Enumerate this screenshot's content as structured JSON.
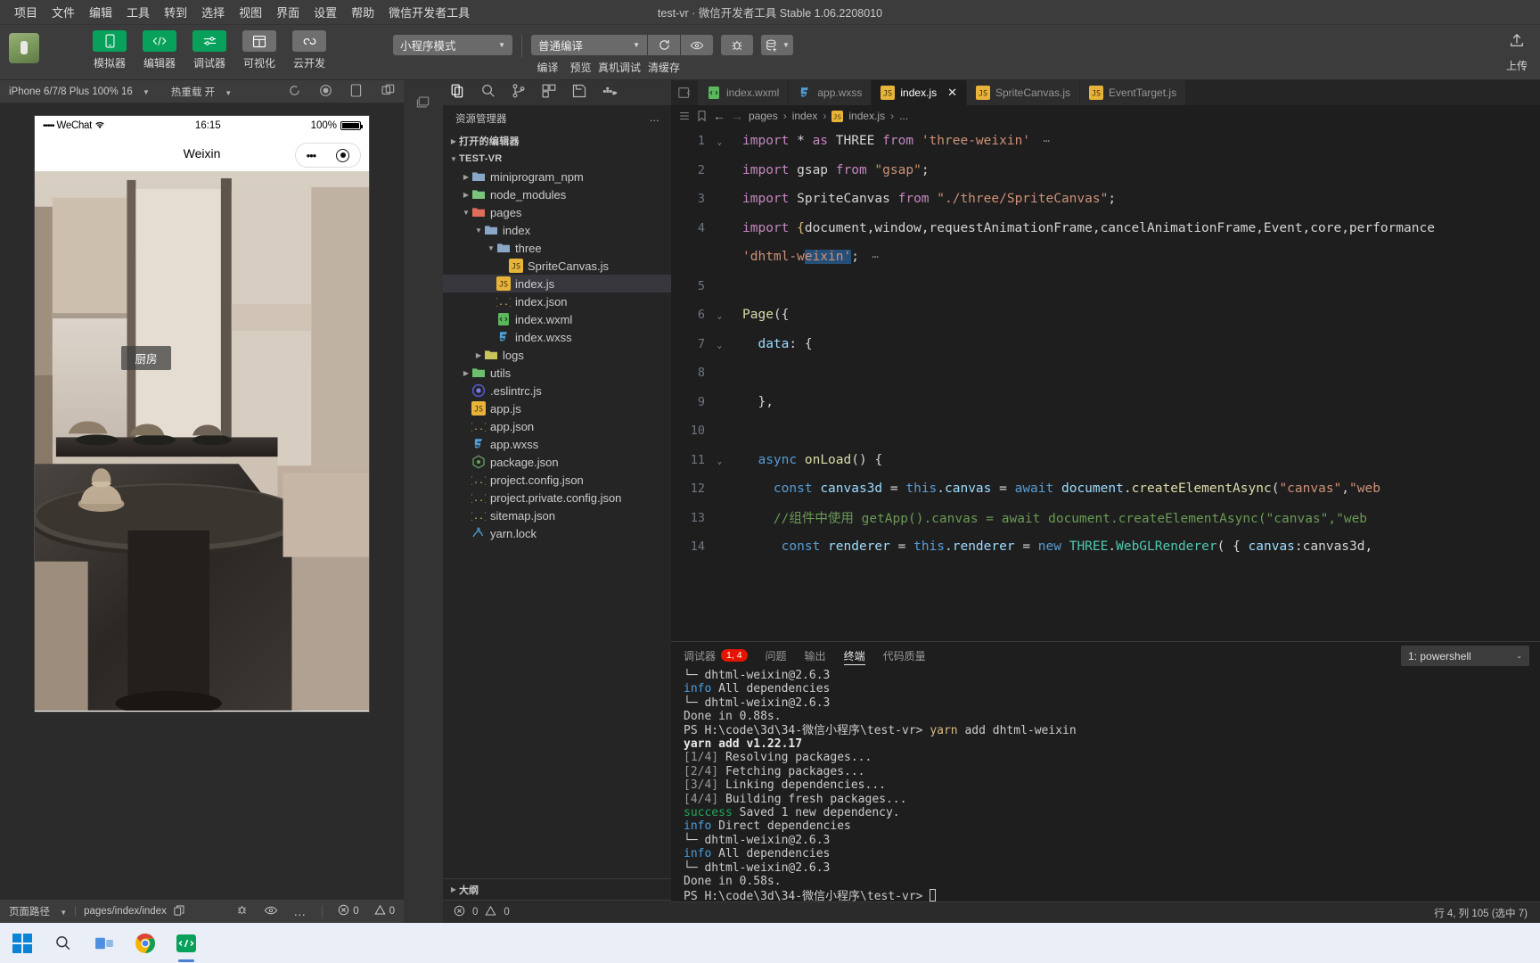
{
  "titlebar": {
    "menus": [
      "项目",
      "文件",
      "编辑",
      "工具",
      "转到",
      "选择",
      "视图",
      "界面",
      "设置",
      "帮助",
      "微信开发者工具"
    ],
    "window_title": "test-vr · 微信开发者工具 Stable 1.06.2208010"
  },
  "toolbar": {
    "buttons": [
      {
        "label": "模拟器",
        "icon": "phone-icon",
        "style": "green"
      },
      {
        "label": "编辑器",
        "icon": "code-icon",
        "style": "green"
      },
      {
        "label": "调试器",
        "icon": "sliders-icon",
        "style": "green"
      },
      {
        "label": "可视化",
        "icon": "layout-icon",
        "style": "grey"
      },
      {
        "label": "云开发",
        "icon": "cloud-icon",
        "style": "grey"
      }
    ],
    "mode_select": "小程序模式",
    "compile_select": "普通编译",
    "action_labels": [
      "编译",
      "预览",
      "真机调试",
      "清缓存"
    ],
    "upload_label": "上传",
    "upload_icon": "upload-icon"
  },
  "simulator": {
    "device": "iPhone 6/7/8 Plus 100% 16",
    "hot_reload": "热重载 开",
    "icons": [
      "refresh-icon",
      "record-icon",
      "rotate-icon",
      "detach-icon"
    ],
    "phone": {
      "carrier": "WeChat",
      "signal_dots": "•••••",
      "time": "16:15",
      "battery_percent": "100%",
      "nav_title": "Weixin",
      "capsule_more_icon": "more-dots-icon",
      "capsule_close_icon": "target-icon",
      "scene_label": "厨房"
    },
    "status": {
      "path_label": "页面路径",
      "path_value": "pages/index/index",
      "copy_icon": "copy-icon",
      "right_icons": [
        "bug-icon",
        "eye-icon",
        "more-icon"
      ],
      "errors": "0",
      "warnings": "0",
      "error_icon": "error-circle-icon",
      "warning_icon": "warning-triangle-icon"
    }
  },
  "activity_bar": {
    "items": [
      {
        "name": "explorer-icon",
        "active": true
      },
      {
        "name": "search-icon",
        "active": false
      },
      {
        "name": "source-control-icon",
        "active": false
      },
      {
        "name": "extensions-icon",
        "active": false
      },
      {
        "name": "save-icon",
        "active": false
      },
      {
        "name": "docker-icon",
        "active": false
      }
    ]
  },
  "explorer": {
    "title": "资源管理器",
    "more_icon": "ellipsis-icon",
    "open_editors": "打开的编辑器",
    "project_root": "TEST-VR",
    "outline": "大纲",
    "tree": [
      {
        "label": "miniprogram_npm",
        "depth": 1,
        "type": "folder",
        "twisty": "collapsed",
        "color": "#8aa7c7"
      },
      {
        "label": "node_modules",
        "depth": 1,
        "type": "folder",
        "twisty": "collapsed",
        "color": "#7cc47c"
      },
      {
        "label": "pages",
        "depth": 1,
        "type": "folder",
        "twisty": "expanded",
        "color": "#e06c5a"
      },
      {
        "label": "index",
        "depth": 2,
        "type": "folder",
        "twisty": "expanded",
        "color": "#8aa7c7"
      },
      {
        "label": "three",
        "depth": 3,
        "type": "folder",
        "twisty": "expanded",
        "color": "#8aa7c7"
      },
      {
        "label": "SpriteCanvas.js",
        "depth": 4,
        "type": "js",
        "twisty": "none"
      },
      {
        "label": "index.js",
        "depth": 3,
        "type": "js",
        "twisty": "none",
        "selected": true
      },
      {
        "label": "index.json",
        "depth": 3,
        "type": "json",
        "twisty": "none"
      },
      {
        "label": "index.wxml",
        "depth": 3,
        "type": "wxml",
        "twisty": "none"
      },
      {
        "label": "index.wxss",
        "depth": 3,
        "type": "wxss",
        "twisty": "none"
      },
      {
        "label": "logs",
        "depth": 2,
        "type": "folder",
        "twisty": "collapsed",
        "color": "#c9c45a"
      },
      {
        "label": "utils",
        "depth": 1,
        "type": "folder",
        "twisty": "collapsed",
        "color": "#6cbf6c"
      },
      {
        "label": ".eslintrc.js",
        "depth": 1,
        "type": "eslint",
        "twisty": "none"
      },
      {
        "label": "app.js",
        "depth": 1,
        "type": "js",
        "twisty": "none"
      },
      {
        "label": "app.json",
        "depth": 1,
        "type": "json",
        "twisty": "none"
      },
      {
        "label": "app.wxss",
        "depth": 1,
        "type": "wxss",
        "twisty": "none"
      },
      {
        "label": "package.json",
        "depth": 1,
        "type": "npm",
        "twisty": "none"
      },
      {
        "label": "project.config.json",
        "depth": 1,
        "type": "json",
        "twisty": "none"
      },
      {
        "label": "project.private.config.json",
        "depth": 1,
        "type": "json",
        "twisty": "none"
      },
      {
        "label": "sitemap.json",
        "depth": 1,
        "type": "json",
        "twisty": "none"
      },
      {
        "label": "yarn.lock",
        "depth": 1,
        "type": "yarn",
        "twisty": "none"
      }
    ]
  },
  "editor": {
    "tabs": [
      {
        "label": "index.wxml",
        "type": "wxml",
        "active": false
      },
      {
        "label": "app.wxss",
        "type": "wxss",
        "active": false
      },
      {
        "label": "index.js",
        "type": "js",
        "active": true,
        "close_icon": "close-icon"
      },
      {
        "label": "SpriteCanvas.js",
        "type": "js",
        "active": false
      },
      {
        "label": "EventTarget.js",
        "type": "js",
        "active": false
      }
    ],
    "breadcrumb": [
      "pages",
      "index",
      "index.js",
      "..."
    ],
    "breadcrumb_icons": [
      "menu-icon",
      "bookmark-icon",
      "arrow-left-icon",
      "arrow-right-icon"
    ],
    "lines": [
      {
        "n": "1",
        "fold": "expanded",
        "tokens": [
          {
            "t": "import ",
            "c": "kw"
          },
          {
            "t": "*",
            "c": "op"
          },
          {
            "t": " as ",
            "c": "kw"
          },
          {
            "t": "THREE",
            "c": "plain"
          },
          {
            "t": " from ",
            "c": "kw"
          },
          {
            "t": "'three-weixin'",
            "c": "str"
          }
        ],
        "trailing_ellipsis": true
      },
      {
        "n": "2",
        "fold": "",
        "tokens": [
          {
            "t": "import ",
            "c": "kw"
          },
          {
            "t": "gsap",
            "c": "plain"
          },
          {
            "t": " from ",
            "c": "kw"
          },
          {
            "t": "\"gsap\"",
            "c": "str"
          },
          {
            "t": ";",
            "c": "op"
          }
        ]
      },
      {
        "n": "3",
        "fold": "",
        "tokens": [
          {
            "t": "import ",
            "c": "kw"
          },
          {
            "t": "SpriteCanvas",
            "c": "plain"
          },
          {
            "t": " from ",
            "c": "kw"
          },
          {
            "t": "\"./three/SpriteCanvas\"",
            "c": "str"
          },
          {
            "t": ";",
            "c": "op"
          }
        ]
      },
      {
        "n": "4",
        "fold": "",
        "tokens": [
          {
            "t": "import ",
            "c": "kw"
          },
          {
            "t": "{",
            "c": "warn-brace"
          },
          {
            "t": "document,window,requestAnimationFrame,cancelAnimationFrame,Event,core,performance",
            "c": "plain"
          }
        ]
      },
      {
        "n": "",
        "fold": "",
        "wrap": true,
        "tokens": [
          {
            "t": "'dhtml-w",
            "c": "str"
          },
          {
            "t": "eixin'",
            "c": "str sel"
          },
          {
            "t": ";",
            "c": "op"
          }
        ],
        "trailing_ellipsis": true
      },
      {
        "n": "5",
        "fold": "",
        "tokens": []
      },
      {
        "n": "6",
        "fold": "expanded",
        "tokens": [
          {
            "t": "Page",
            "c": "fn"
          },
          {
            "t": "({",
            "c": "op"
          }
        ]
      },
      {
        "n": "7",
        "fold": "expanded",
        "tokens": [
          {
            "t": "  data",
            "c": "var"
          },
          {
            "t": ": {",
            "c": "op"
          }
        ]
      },
      {
        "n": "8",
        "fold": "",
        "tokens": []
      },
      {
        "n": "9",
        "fold": "",
        "tokens": [
          {
            "t": "  },",
            "c": "op"
          }
        ]
      },
      {
        "n": "10",
        "fold": "",
        "tokens": []
      },
      {
        "n": "11",
        "fold": "expanded",
        "tokens": [
          {
            "t": "  ",
            "c": "plain"
          },
          {
            "t": "async ",
            "c": "kw2"
          },
          {
            "t": "onLoad",
            "c": "fn"
          },
          {
            "t": "() {",
            "c": "op"
          }
        ]
      },
      {
        "n": "12",
        "fold": "",
        "tokens": [
          {
            "t": "    ",
            "c": "plain"
          },
          {
            "t": "const ",
            "c": "kw2"
          },
          {
            "t": "canvas3d",
            "c": "var"
          },
          {
            "t": " = ",
            "c": "op"
          },
          {
            "t": "this",
            "c": "kw2"
          },
          {
            "t": ".canvas",
            "c": "var"
          },
          {
            "t": " = ",
            "c": "op"
          },
          {
            "t": "await ",
            "c": "kw2"
          },
          {
            "t": "document",
            "c": "var"
          },
          {
            "t": ".",
            "c": "op"
          },
          {
            "t": "createElementAsync",
            "c": "fn"
          },
          {
            "t": "(",
            "c": "op"
          },
          {
            "t": "\"canvas\"",
            "c": "str"
          },
          {
            "t": ",",
            "c": "op"
          },
          {
            "t": "\"web",
            "c": "str"
          }
        ]
      },
      {
        "n": "13",
        "fold": "",
        "tokens": [
          {
            "t": "    //组件中使用 getApp().canvas = await document.createElementAsync(\"canvas\",\"web",
            "c": "cmt"
          }
        ]
      },
      {
        "n": "14",
        "fold": "",
        "tokens": [
          {
            "t": "     ",
            "c": "plain"
          },
          {
            "t": "const ",
            "c": "kw2"
          },
          {
            "t": "renderer",
            "c": "var"
          },
          {
            "t": " = ",
            "c": "op"
          },
          {
            "t": "this",
            "c": "kw2"
          },
          {
            "t": ".renderer",
            "c": "var"
          },
          {
            "t": " = ",
            "c": "op"
          },
          {
            "t": "new ",
            "c": "kw2"
          },
          {
            "t": "THREE",
            "c": "ty"
          },
          {
            "t": ".",
            "c": "op"
          },
          {
            "t": "WebGLRenderer",
            "c": "ty"
          },
          {
            "t": "( { ",
            "c": "op"
          },
          {
            "t": "canvas",
            "c": "var"
          },
          {
            "t": ":canvas3d,",
            "c": "op"
          }
        ]
      }
    ],
    "status_right": "行 4, 列 105 (选中 7)"
  },
  "panel": {
    "tabs": [
      {
        "label": "调试器",
        "badge": "1, 4",
        "active": false
      },
      {
        "label": "问题",
        "badge": "",
        "active": false
      },
      {
        "label": "输出",
        "badge": "",
        "active": false
      },
      {
        "label": "终端",
        "badge": "",
        "active": true
      },
      {
        "label": "代码质量",
        "badge": "",
        "active": false
      }
    ],
    "terminal_select": "1: powershell",
    "terminal_select_icon": "chevron-down-icon",
    "terminal_lines": [
      [
        {
          "t": "└─ dhtml-weixin@2.6.3",
          "c": ""
        }
      ],
      [
        {
          "t": "info",
          "c": "t-info"
        },
        {
          "t": " All dependencies",
          "c": ""
        }
      ],
      [
        {
          "t": "└─ dhtml-weixin@2.6.3",
          "c": ""
        }
      ],
      [
        {
          "t": "Done in 0.88s.",
          "c": ""
        }
      ],
      [
        {
          "t": "PS H:\\code\\3d\\34-微信小程序\\test-vr> ",
          "c": ""
        },
        {
          "t": "yarn",
          "c": "t-warn"
        },
        {
          "t": " add dhtml-weixin",
          "c": ""
        }
      ],
      [
        {
          "t": "yarn add v1.22.17",
          "c": "t-b"
        }
      ],
      [
        {
          "t": "[1/4]",
          "c": "t-dim"
        },
        {
          "t": " Resolving packages...",
          "c": ""
        }
      ],
      [
        {
          "t": "[2/4]",
          "c": "t-dim"
        },
        {
          "t": " Fetching packages...",
          "c": ""
        }
      ],
      [
        {
          "t": "[3/4]",
          "c": "t-dim"
        },
        {
          "t": " Linking dependencies...",
          "c": ""
        }
      ],
      [
        {
          "t": "[4/4]",
          "c": "t-dim"
        },
        {
          "t": " Building fresh packages...",
          "c": ""
        }
      ],
      [
        {
          "t": "success",
          "c": "t-succ"
        },
        {
          "t": " Saved 1 new dependency.",
          "c": ""
        }
      ],
      [
        {
          "t": "info",
          "c": "t-info"
        },
        {
          "t": " Direct dependencies",
          "c": ""
        }
      ],
      [
        {
          "t": "└─ dhtml-weixin@2.6.3",
          "c": ""
        }
      ],
      [
        {
          "t": "info",
          "c": "t-info"
        },
        {
          "t": " All dependencies",
          "c": ""
        }
      ],
      [
        {
          "t": "└─ dhtml-weixin@2.6.3",
          "c": ""
        }
      ],
      [
        {
          "t": "Done in 0.58s.",
          "c": ""
        }
      ],
      [
        {
          "t": "PS H:\\code\\3d\\34-微信小程序\\test-vr> ",
          "c": ""
        },
        {
          "t": "▯",
          "c": "cursor"
        }
      ]
    ]
  },
  "taskbar": {
    "items": [
      "start-icon",
      "search-icon",
      "task-view-icon",
      "chrome-icon",
      "wechat-devtools-icon"
    ]
  },
  "colors": {
    "accent_green": "#07a15c",
    "selection_blue": "#264f78",
    "badge_red": "#e51400",
    "tab_active_bg": "#1e1e1e"
  }
}
